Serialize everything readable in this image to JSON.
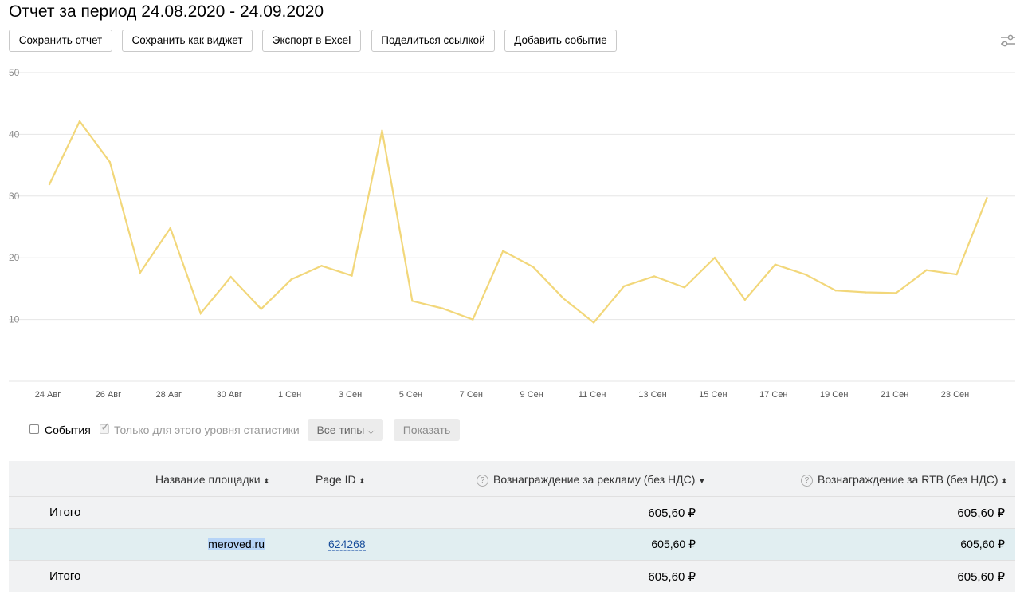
{
  "page": {
    "title": "Отчет за период 24.08.2020 - 24.09.2020"
  },
  "toolbar": {
    "save_report": "Сохранить отчет",
    "save_widget": "Сохранить как виджет",
    "export_excel": "Экспорт в Excel",
    "share_link": "Поделиться ссылкой",
    "add_event": "Добавить событие",
    "settings_icon": "sliders-icon"
  },
  "chart_data": {
    "type": "line",
    "title": "",
    "xlabel": "",
    "ylabel": "",
    "ylim": [
      0,
      50
    ],
    "yticks": [
      10,
      20,
      30,
      40,
      50
    ],
    "grid": true,
    "x_tick_labels": [
      "24 Авг",
      "26 Авг",
      "28 Авг",
      "30 Авг",
      "1 Сен",
      "3 Сен",
      "5 Сен",
      "7 Сен",
      "9 Сен",
      "11 Сен",
      "13 Сен",
      "15 Сен",
      "17 Сен",
      "19 Сен",
      "21 Сен",
      "23 Сен"
    ],
    "x": [
      "24 Авг",
      "25 Авг",
      "26 Авг",
      "27 Авг",
      "28 Авг",
      "29 Авг",
      "30 Авг",
      "31 Авг",
      "1 Сен",
      "2 Сен",
      "3 Сен",
      "4 Сен",
      "5 Сен",
      "6 Сен",
      "7 Сен",
      "8 Сен",
      "9 Сен",
      "10 Сен",
      "11 Сен",
      "12 Сен",
      "13 Сен",
      "14 Сен",
      "15 Сен",
      "16 Сен",
      "17 Сен",
      "18 Сен",
      "19 Сен",
      "20 Сен",
      "21 Сен",
      "22 Сен",
      "23 Сен",
      "24 Сен"
    ],
    "series": [
      {
        "color": "#f2d77a",
        "values": [
          31.9,
          42.1,
          35.5,
          17.6,
          24.8,
          11.0,
          16.9,
          11.7,
          16.5,
          18.7,
          17.1,
          40.6,
          13.0,
          11.8,
          10.0,
          21.1,
          18.5,
          13.4,
          9.5,
          15.4,
          17.0,
          15.2,
          20.0,
          13.2,
          18.9,
          17.3,
          14.7,
          14.4,
          14.3,
          18.0,
          17.3,
          29.7
        ]
      }
    ]
  },
  "controls": {
    "events_label": "События",
    "only_level_label": "Только для этого уровня статистики",
    "all_types": "Все типы",
    "show_button": "Показать"
  },
  "table": {
    "headers": {
      "site_name": "Название площадки",
      "page_id": "Page ID",
      "ad_reward": "Вознаграждение за рекламу (без НДС)",
      "rtb_reward": "Вознаграждение за RTB (без НДС)"
    },
    "top_total": {
      "label": "Итого",
      "ad_reward": "605,60 ₽",
      "rtb_reward": "605,60 ₽"
    },
    "rows": [
      {
        "site_name": "meroved.ru",
        "page_id": "624268",
        "ad_reward": "605,60 ₽",
        "rtb_reward": "605,60 ₽"
      }
    ],
    "bottom_total": {
      "label": "Итого",
      "ad_reward": "605,60 ₽",
      "rtb_reward": "605,60 ₽"
    }
  }
}
